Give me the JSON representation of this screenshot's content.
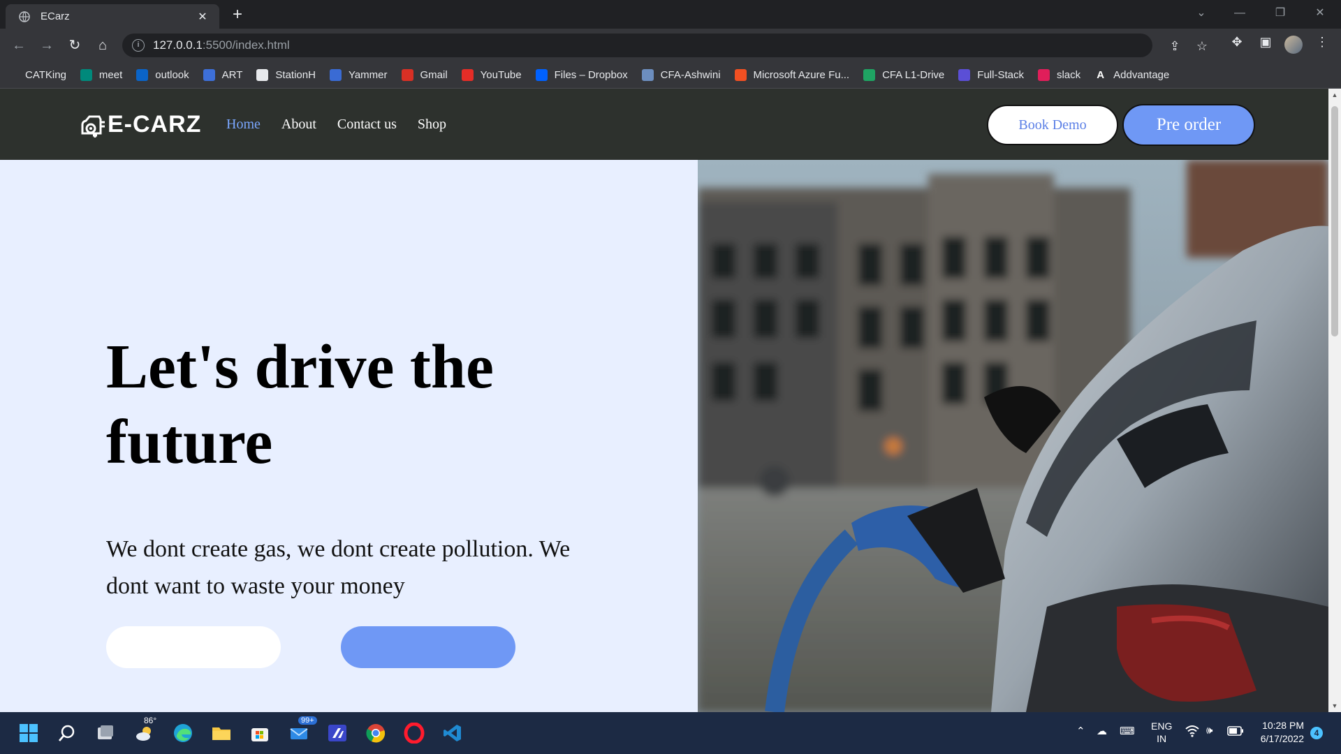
{
  "browser": {
    "tab_title": "ECarz",
    "url_host": "127.0.0.1",
    "url_rest": ":5500/index.html",
    "bookmarks": [
      {
        "label": "CATKing",
        "icon": "catking-icon",
        "color": "#202124"
      },
      {
        "label": "meet",
        "icon": "google-meet-icon",
        "color": "#00897b"
      },
      {
        "label": "outlook",
        "icon": "outlook-icon",
        "color": "#0a64c8"
      },
      {
        "label": "ART",
        "icon": "art-icon",
        "color": "#3d6fd8"
      },
      {
        "label": "StationH",
        "icon": "document-icon",
        "color": "#e8eaed"
      },
      {
        "label": "Yammer",
        "icon": "yammer-icon",
        "color": "#3a6bd4"
      },
      {
        "label": "Gmail",
        "icon": "gmail-icon",
        "color": "#d93025"
      },
      {
        "label": "YouTube",
        "icon": "youtube-icon",
        "color": "#e52d27"
      },
      {
        "label": "Files – Dropbox",
        "icon": "dropbox-icon",
        "color": "#0061fe"
      },
      {
        "label": "CFA-Ashwini",
        "icon": "bookmark-icon",
        "color": "#6c8ebf"
      },
      {
        "label": "Microsoft Azure Fu...",
        "icon": "microsoft-icon",
        "color": "#f25022"
      },
      {
        "label": "CFA L1-Drive",
        "icon": "google-drive-icon",
        "color": "#1fa463"
      },
      {
        "label": "Full-Stack",
        "icon": "hexagon-icon",
        "color": "#5b4fd6"
      },
      {
        "label": "slack",
        "icon": "slack-icon",
        "color": "#e01e5a"
      },
      {
        "label": "Addvantage",
        "icon": "addvantage-icon",
        "color": "#ffffff"
      }
    ]
  },
  "site": {
    "logo_text": "E-CARZ",
    "nav": [
      {
        "label": "Home",
        "active": true
      },
      {
        "label": "About",
        "active": false
      },
      {
        "label": "Contact us",
        "active": false
      },
      {
        "label": "Shop",
        "active": false
      }
    ],
    "book_demo_label": "Book Demo",
    "pre_order_label": "Pre order",
    "hero_title": "Let's drive the future",
    "hero_subtitle": "We dont create gas, we dont create pollution. We dont want to waste your money",
    "hero_image_alt": "electric-car-charging-photo",
    "colors": {
      "accent": "#6f98f5",
      "navbar": "#2d312d",
      "hero_bg": "#e8efff"
    }
  },
  "taskbar": {
    "weather_temp": "86°",
    "mail_badge": "99+",
    "lang_line1": "ENG",
    "lang_line2": "IN",
    "time": "10:28 PM",
    "date": "6/17/2022",
    "notification_count": "4"
  }
}
